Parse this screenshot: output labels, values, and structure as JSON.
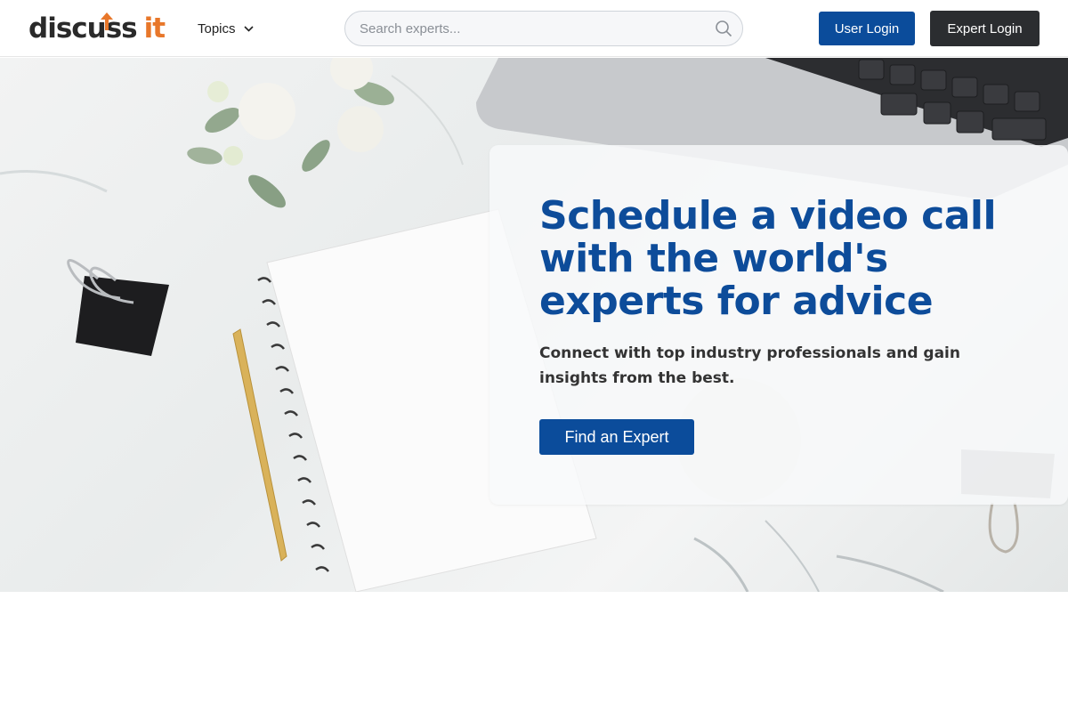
{
  "header": {
    "logo": {
      "part1": "discu",
      "part2": "ss",
      "part3": "it"
    },
    "topics_label": "Topics",
    "search": {
      "placeholder": "Search experts...",
      "value": ""
    },
    "user_login_label": "User Login",
    "expert_login_label": "Expert Login"
  },
  "hero": {
    "headline": "Schedule a video call with the world's experts for advice",
    "subheading": "Connect with top industry professionals and gain insights from the best.",
    "cta_label": "Find an Expert"
  },
  "colors": {
    "brand_blue": "#0b4c9b",
    "headline_blue": "#0d4c9a",
    "logo_orange": "#e8772a",
    "dark_button": "#2b2d30"
  },
  "icons": [
    "search-icon",
    "chevron-down-icon",
    "logo-arrow-icon"
  ]
}
